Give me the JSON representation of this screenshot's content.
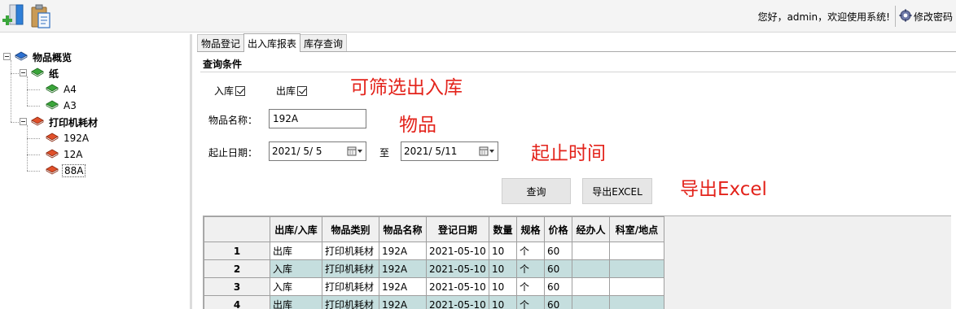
{
  "header": {
    "welcome_text": "您好，admin，欢迎使用系统!",
    "change_password": "修改密码",
    "icons": [
      "add-icon",
      "clipboard-icon",
      "gear-icon"
    ]
  },
  "tree": {
    "root": "物品概览",
    "groups": [
      {
        "label": "纸",
        "items": [
          "A4",
          "A3"
        ]
      },
      {
        "label": "打印机耗材",
        "items": [
          "192A",
          "12A",
          "88A"
        ]
      }
    ]
  },
  "tabs": [
    "物品登记",
    "出入库报表",
    "库存查询"
  ],
  "active_tab": "出入库报表",
  "query": {
    "section_title": "查询条件",
    "in_label": "入库",
    "in_checked": true,
    "out_label": "出库",
    "out_checked": true,
    "name_label": "物品名称：",
    "name_value": "192A",
    "date_label": "起止日期：",
    "start_date": "2021/ 5/ 5",
    "to_label": "至",
    "end_date": "2021/ 5/11",
    "search_button": "查询",
    "export_button": "导出EXCEL"
  },
  "annotations": {
    "filter": "可筛选出入库",
    "item": "物品",
    "date": "起止时间",
    "export": "导出Excel"
  },
  "annotation_color": "#e3231b",
  "grid": {
    "columns": [
      "出库/入库",
      "物品类别",
      "物品名称",
      "登记日期",
      "数量",
      "规格",
      "价格",
      "经办人",
      "科室/地点"
    ],
    "rows": [
      {
        "num": "1",
        "cells": [
          "出库",
          "打印机耗材",
          "192A",
          "2021-05-10",
          "10",
          "个",
          "60",
          "",
          ""
        ]
      },
      {
        "num": "2",
        "cells": [
          "入库",
          "打印机耗材",
          "192A",
          "2021-05-10",
          "10",
          "个",
          "60",
          "",
          ""
        ]
      },
      {
        "num": "3",
        "cells": [
          "入库",
          "打印机耗材",
          "192A",
          "2021-05-10",
          "10",
          "个",
          "60",
          "",
          ""
        ]
      },
      {
        "num": "4",
        "cells": [
          "出库",
          "打印机耗材",
          "192A",
          "2021-05-10",
          "10",
          "个",
          "60",
          "",
          ""
        ]
      }
    ],
    "alt_row_color": "#c5dede"
  }
}
